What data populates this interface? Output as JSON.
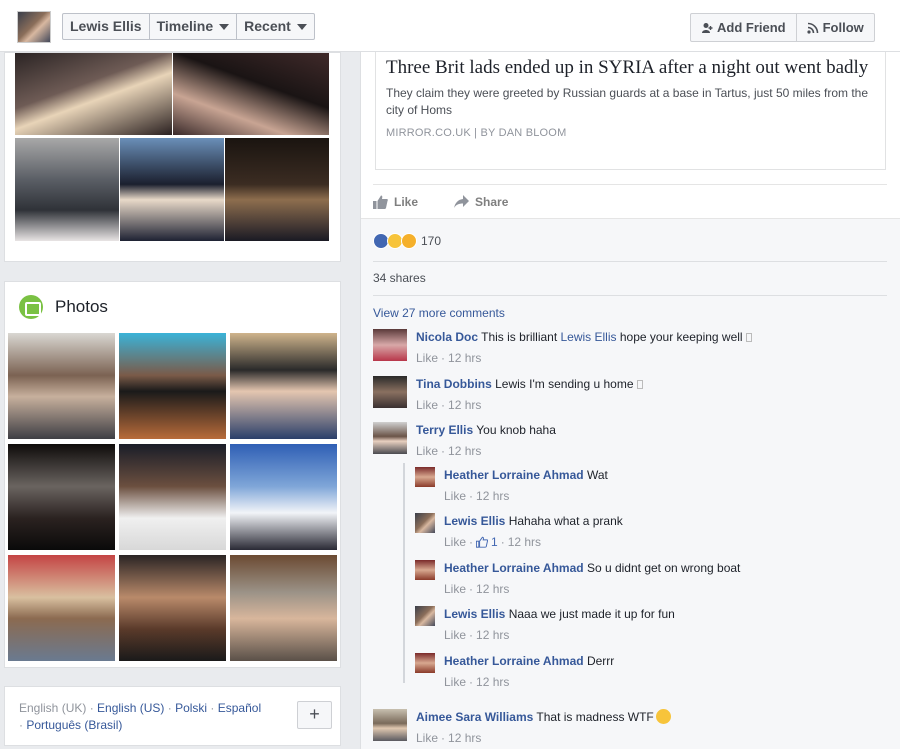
{
  "profile": {
    "name": "Lewis Ellis",
    "nav": {
      "timeline_label": "Timeline",
      "recent_label": "Recent"
    },
    "actions": {
      "add_friend_label": "Add Friend",
      "follow_label": "Follow"
    }
  },
  "left": {
    "photos_title": "Photos",
    "languages": [
      "English (UK)",
      "English (US)",
      "Polski",
      "Español",
      "Português (Brasil)"
    ],
    "add_language_label": "+"
  },
  "post": {
    "link": {
      "title": "Three Brit lads ended up in SYRIA after a night out went badly",
      "description": "They claim they were greeted by Russian guards at a base in Tartus, just 50 miles from the city of Homs",
      "source": "MIRROR.CO.UK",
      "author": "BY DAN BLOOM"
    },
    "like_label": "Like",
    "share_label": "Share",
    "reactions_count": "170",
    "shares_label": "34 shares",
    "view_more_label": "View 27 more comments",
    "comments": [
      {
        "name": "Nicola Doc",
        "pre": "This is brilliant ",
        "mention": "Lewis Ellis",
        "post": " hope your keeping well",
        "like": "Like",
        "time": "12 hrs"
      },
      {
        "name": "Tina Dobbins",
        "pre": "Lewis I'm sending u home",
        "mention": "",
        "post": "",
        "like": "Like",
        "time": "12 hrs"
      },
      {
        "name": "Terry Ellis",
        "pre": "You knob haha",
        "mention": "",
        "post": "",
        "like": "Like",
        "time": "12 hrs"
      }
    ],
    "replies": [
      {
        "name": "Heather Lorraine Ahmad",
        "text": "Wat",
        "like": "Like",
        "time": "12 hrs"
      },
      {
        "name": "Lewis Ellis",
        "text": "Hahaha what a prank",
        "like": "Like",
        "likes": "1",
        "time": "12 hrs"
      },
      {
        "name": "Heather Lorraine Ahmad",
        "text": "So u didnt get on wrong boat",
        "like": "Like",
        "time": "12 hrs"
      },
      {
        "name": "Lewis Ellis",
        "text": "Naaa we just made it up for fun",
        "like": "Like",
        "time": "12 hrs"
      },
      {
        "name": "Heather Lorraine Ahmad",
        "text": "Derrr",
        "like": "Like",
        "time": "12 hrs"
      }
    ],
    "last_comment": {
      "name": "Aimee Sara Williams",
      "text": "That is madness WTF",
      "like": "Like",
      "time": "12 hrs"
    }
  },
  "colors": {
    "link": "#365899",
    "like_blue": "#4267b2",
    "photos_green": "#7ac143"
  }
}
